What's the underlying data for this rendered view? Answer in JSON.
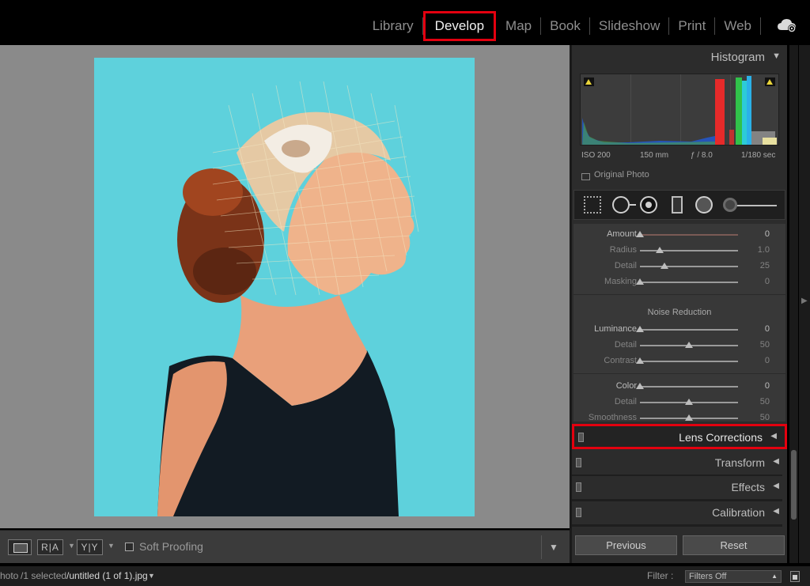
{
  "app": {
    "modules": [
      "Library",
      "Develop",
      "Map",
      "Book",
      "Slideshow",
      "Print",
      "Web"
    ],
    "active_module": "Develop",
    "accent_color": "#e3000f"
  },
  "toolbar": {
    "view_before_after_lr": "R|A",
    "view_before_after_tb": "Y|Y",
    "soft_proofing_label": "Soft Proofing",
    "soft_proofing_checked": false
  },
  "filmstrip": {
    "source_fragment": "hoto",
    "count": "/1 selected",
    "file": "/untitled (1 of 1).jpg",
    "filter_label": "Filter :",
    "filter_value": "Filters Off"
  },
  "histogram": {
    "title": "Histogram",
    "iso": "ISO 200",
    "focal_length": "150 mm",
    "aperture": "ƒ / 8.0",
    "shutter": "1/180 sec",
    "original_photo_label": "Original Photo"
  },
  "tools": [
    "crop-overlay",
    "spot-removal",
    "red-eye-correction",
    "graduated-filter",
    "radial-filter",
    "adjustment-brush"
  ],
  "detail": {
    "sharpening": [
      {
        "label": "Amount",
        "value": "0",
        "fraction": 0.0,
        "dim": false
      },
      {
        "label": "Radius",
        "value": "1.0",
        "fraction": 0.2,
        "dim": true
      },
      {
        "label": "Detail",
        "value": "25",
        "fraction": 0.25,
        "dim": true
      },
      {
        "label": "Masking",
        "value": "0",
        "fraction": 0.0,
        "dim": true
      }
    ],
    "noise_reduction_title": "Noise Reduction",
    "luminance": [
      {
        "label": "Luminance",
        "value": "0",
        "fraction": 0.0,
        "dim": false
      },
      {
        "label": "Detail",
        "value": "50",
        "fraction": 0.5,
        "dim": true
      },
      {
        "label": "Contrast",
        "value": "0",
        "fraction": 0.0,
        "dim": true
      }
    ],
    "color": [
      {
        "label": "Color",
        "value": "0",
        "fraction": 0.0,
        "dim": false
      },
      {
        "label": "Detail",
        "value": "50",
        "fraction": 0.5,
        "dim": true
      },
      {
        "label": "Smoothness",
        "value": "50",
        "fraction": 0.5,
        "dim": true
      }
    ]
  },
  "panels": [
    "Lens Corrections",
    "Transform",
    "Effects",
    "Calibration"
  ],
  "highlighted_panel": "Lens Corrections",
  "buttons": {
    "previous": "Previous",
    "reset": "Reset"
  }
}
